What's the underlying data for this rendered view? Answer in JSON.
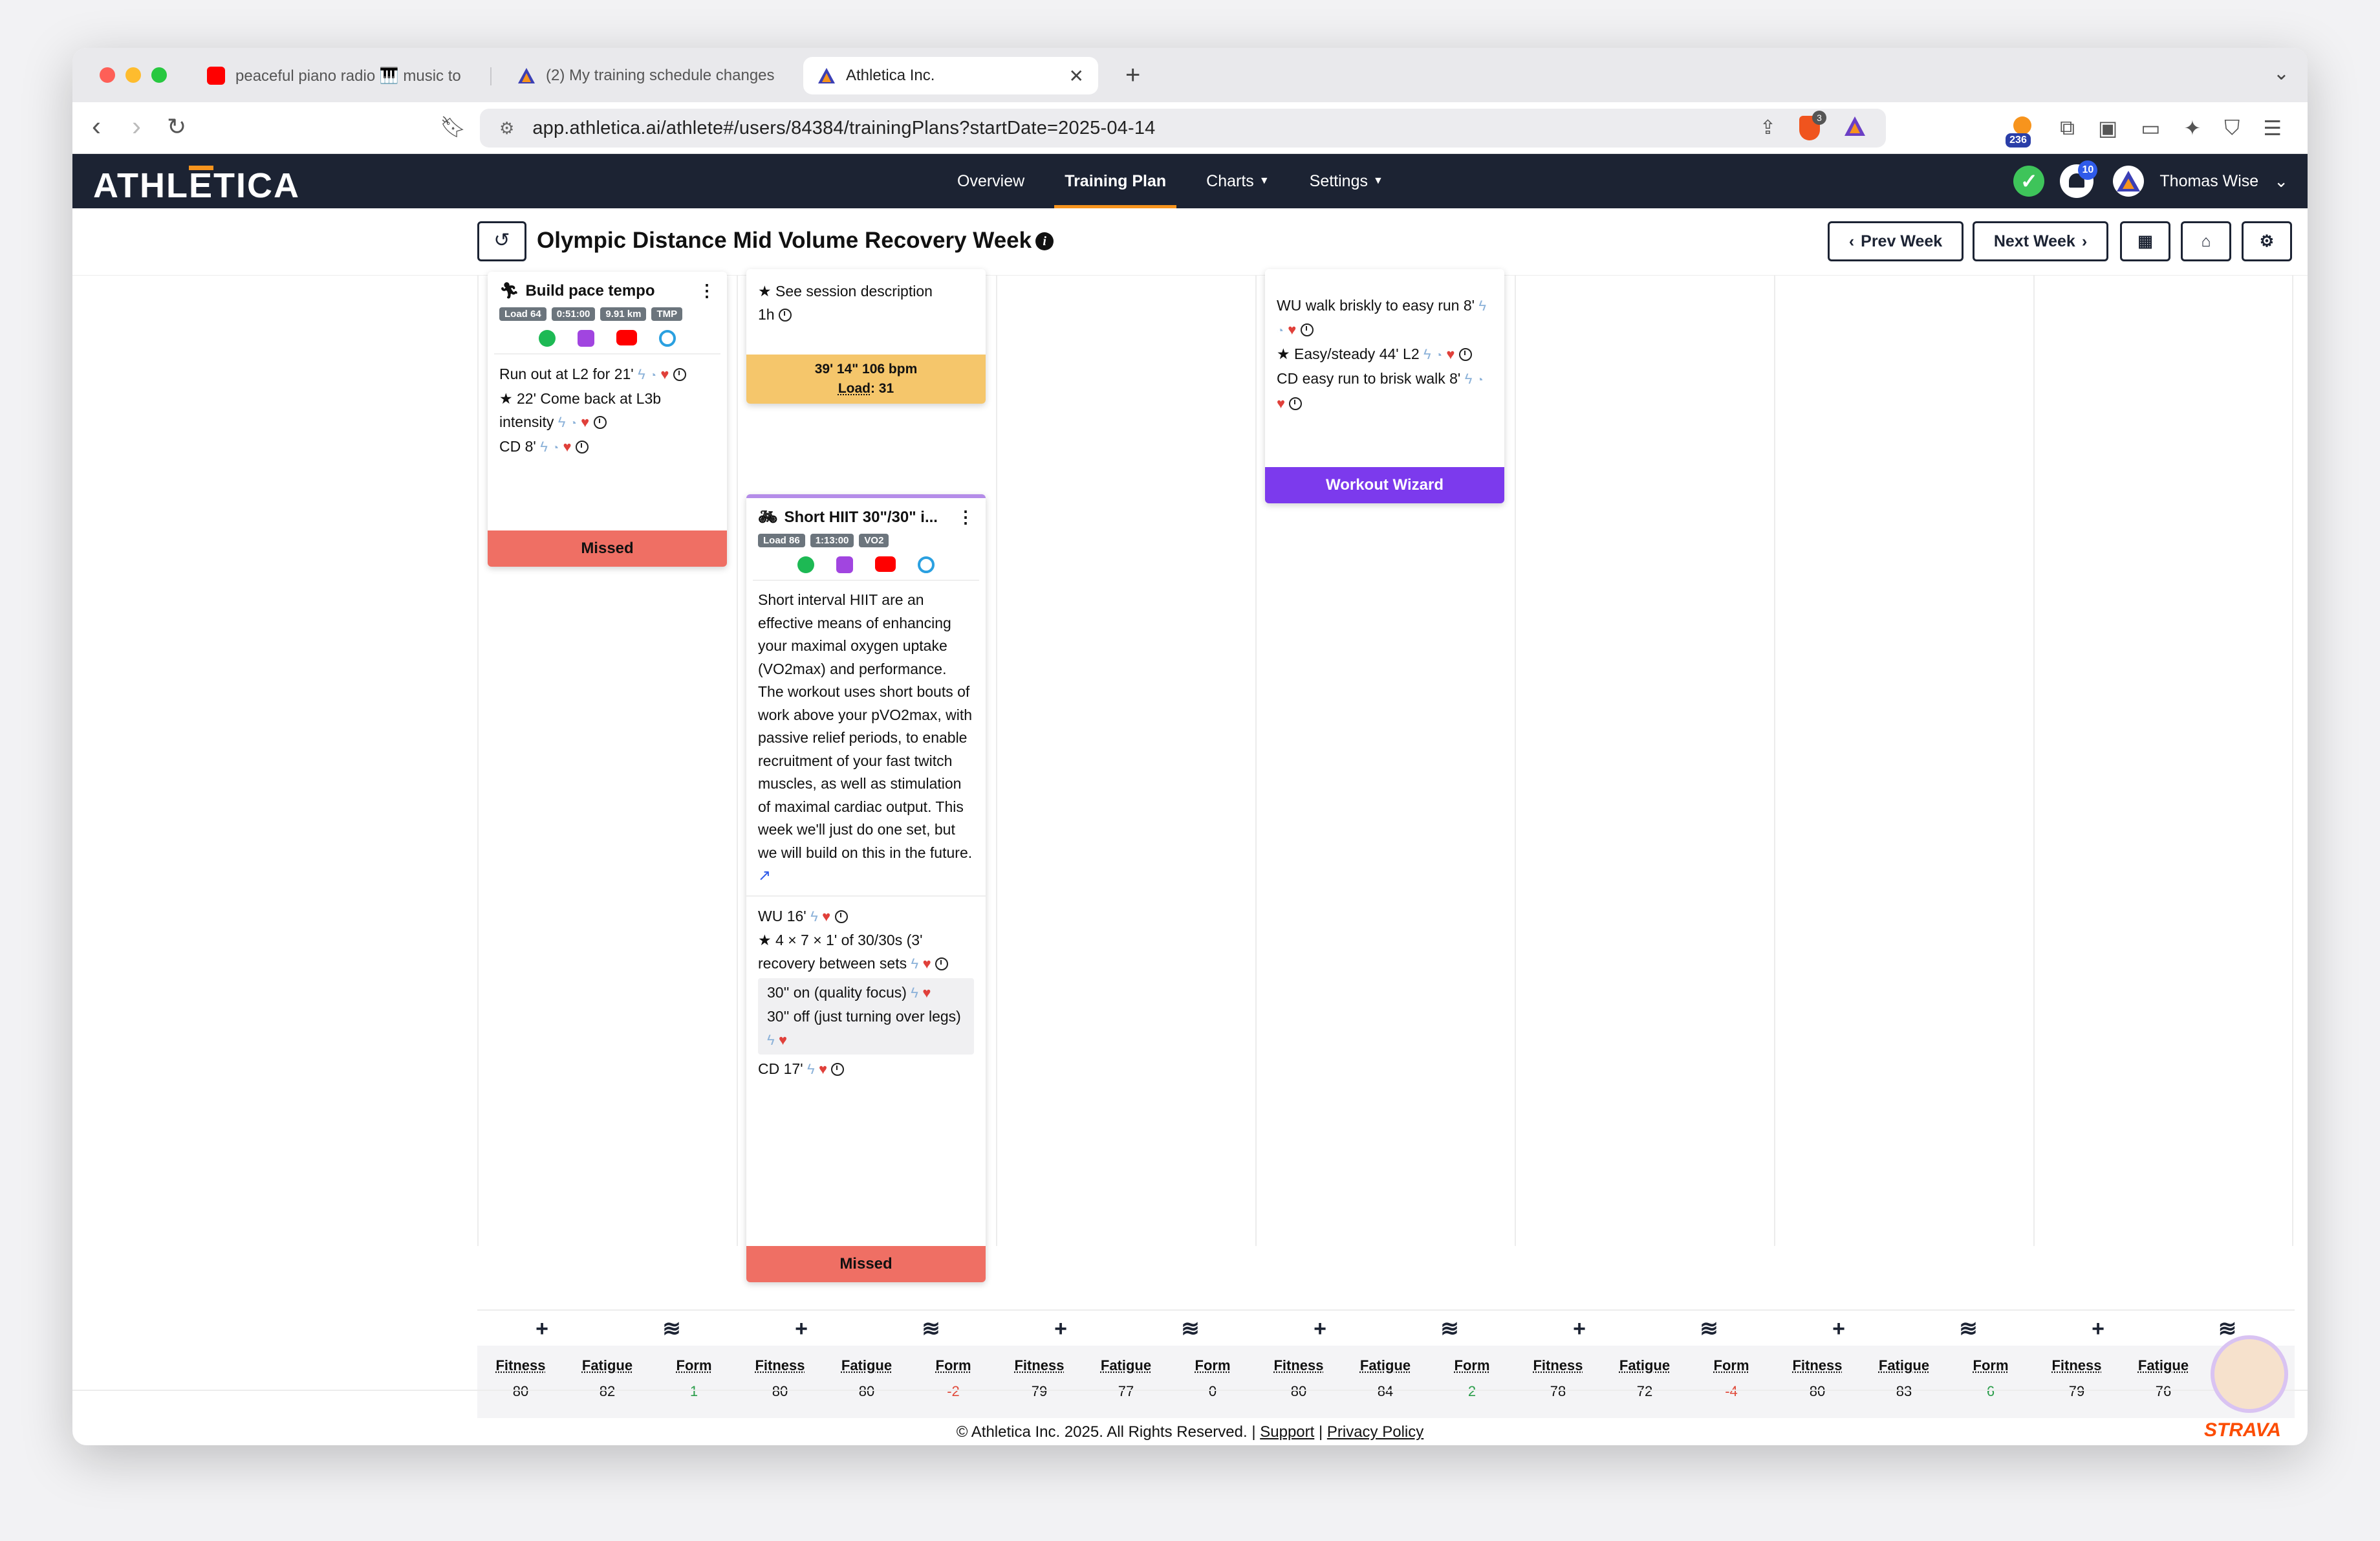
{
  "browser": {
    "tabs": [
      {
        "title": "peaceful piano radio 🎹 music to"
      },
      {
        "title": "(2) My training schedule changes"
      },
      {
        "title": "Athletica Inc."
      }
    ],
    "url": "app.athletica.ai/athlete#/users/84384/trainingPlans?startDate=2025-04-14",
    "extension_badge": "236",
    "brave_badge": "3"
  },
  "appbar": {
    "logo_pre": "ATHL",
    "logo_e": "E",
    "logo_post": "TICA",
    "nav": [
      "Overview",
      "Training Plan",
      "Charts",
      "Settings"
    ],
    "notifications": "10",
    "user_name": "Thomas Wise"
  },
  "plan": {
    "title": "Olympic Distance Mid Volume Recovery Week",
    "prev_week": "Prev Week",
    "next_week": "Next Week"
  },
  "cards": {
    "run": {
      "title": "Build pace tempo",
      "chips": [
        "Load 64",
        "0:51:00",
        "9.91 km",
        "TMP"
      ],
      "step1": "Run out at L2 for 21'",
      "step2": "22' Come back at L3b intensity",
      "step3": "CD 8'",
      "status": "Missed"
    },
    "partial": {
      "step1": "See session description",
      "step2": "1h",
      "planned_line1": "39' 14\"  106 bpm",
      "planned_load_label": "Load",
      "planned_load_value": ": 31"
    },
    "bike": {
      "title": "Short HIIT 30\"/30\" i...",
      "chips": [
        "Load 86",
        "1:13:00",
        "VO2"
      ],
      "description": "Short interval HIIT are an effective means of enhancing your maximal oxygen uptake (VO2max) and performance. The workout uses short bouts of work above your pVO2max, with passive relief periods, to enable recruitment of your fast twitch muscles, as well as stimulation of maximal cardiac output. This week we'll just do one set, but we will build on this in the future.",
      "step1": "WU 16'",
      "step2": "4 × 7 × 1' of 30/30s (3' recovery between sets",
      "sub1": "30'' on (quality focus)",
      "sub2": "30'' off (just turning over legs)",
      "step3": "CD 17'",
      "status": "Missed"
    },
    "walk": {
      "step1": "WU walk briskly to easy run 8'",
      "step2": "Easy/steady 44' L2",
      "step3": "CD easy run to brisk walk 8'",
      "status": "Workout Wizard"
    }
  },
  "stats": [
    {
      "fitness": "80",
      "fatigue": "82",
      "form": "1"
    },
    {
      "fitness": "80",
      "fatigue": "80",
      "form": "-2"
    },
    {
      "fitness": "79",
      "fatigue": "77",
      "form": "0"
    },
    {
      "fitness": "80",
      "fatigue": "84",
      "form": "2"
    },
    {
      "fitness": "78",
      "fatigue": "72",
      "form": "-4"
    },
    {
      "fitness": "80",
      "fatigue": "83",
      "form": "6"
    },
    {
      "fitness": "79",
      "fatigue": "76",
      "form": ""
    }
  ],
  "stat_labels": {
    "fitness": "Fitness",
    "fatigue": "Fatigue",
    "form": "Form"
  },
  "footer": {
    "copyright": "© Athletica Inc. 2025. All Rights Reserved.",
    "sep": "|",
    "support": "Support",
    "privacy": "Privacy Policy",
    "strava": "STRAVA"
  },
  "colors": {
    "navbar": "#1c2333",
    "accent": "#f7941d",
    "missed": "#ef6f64",
    "wizard": "#7c3aed",
    "planned": "#f5c66b"
  }
}
